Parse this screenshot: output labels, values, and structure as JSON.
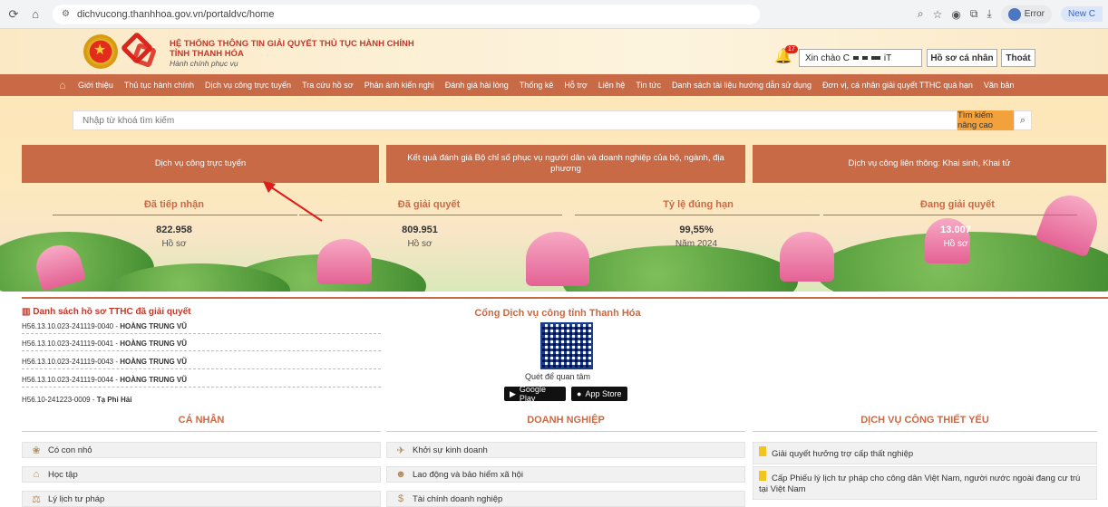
{
  "browser": {
    "url": "dichvucong.thanhhoa.gov.vn/portaldvc/home",
    "profile_label": "Error",
    "new_tab_label": "New C"
  },
  "header": {
    "title": "HỆ THỐNG THÔNG TIN GIẢI QUYẾT THỦ TỤC HÀNH CHÍNH",
    "subtitle": "TỈNH THANH HÓA",
    "tagline": "Hành chính phục vụ",
    "notification_count": "17",
    "greeting": "Xin chào C",
    "greeting_end": "iT",
    "profile_button": "Hồ sơ cá nhân",
    "logout_button": "Thoát"
  },
  "menu": {
    "items": [
      "Giới thiệu",
      "Thủ tục hành chính",
      "Dịch vụ công trực tuyến",
      "Tra cứu hồ sơ",
      "Phản ánh kiến nghị",
      "Đánh giá hài lòng",
      "Thống kê",
      "Hỗ trợ",
      "Liên hệ",
      "Tin tức",
      "Danh sách tài liệu hướng dẫn sử dụng",
      "Đơn vị, cá nhân giải quyết TTHC quá hạn",
      "Văn bản"
    ]
  },
  "search": {
    "placeholder": "Nhập từ khoá tìm kiếm",
    "advanced_button": "Tìm kiếm nâng cao"
  },
  "hero_buttons": {
    "online_services": "Dịch vụ công trực tuyến",
    "evaluation": "Kết quả đánh giá Bộ chỉ số phục vụ người dân và doanh nghiệp của bộ, ngành, địa phương",
    "interconnected": "Dịch vụ công liên thông: Khai sinh, Khai tử"
  },
  "stats": [
    {
      "label": "Đã tiếp nhận",
      "value": "822.958",
      "sub": "Hồ sơ"
    },
    {
      "label": "Đã giải quyết",
      "value": "809.951",
      "sub": "Hồ sơ"
    },
    {
      "label": "Tỷ lệ đúng hạn",
      "value": "99,55%",
      "sub": "Năm 2024"
    },
    {
      "label": "Đang giải quyết",
      "value": "13.007",
      "sub": "Hồ sơ"
    }
  ],
  "resolved_list": {
    "title": "Danh sách hồ sơ TTHC đã giải quyết",
    "rows": [
      {
        "code": "H56.13.10.023-241119-0040 - ",
        "name": "HOÀNG TRUNG VŨ"
      },
      {
        "code": "H56.13.10.023-241119-0041 - ",
        "name": "HOÀNG TRUNG VŨ"
      },
      {
        "code": "H56.13.10.023-241119-0043 - ",
        "name": "HOÀNG TRUNG VŨ"
      },
      {
        "code": "H56.13.10.023-241119-0044 - ",
        "name": "HOÀNG TRUNG VŨ"
      },
      {
        "code": "H56.10-241223-0009 - ",
        "name": "Tạ Phi Hải"
      }
    ]
  },
  "portal": {
    "title": "Cổng Dịch vụ công tỉnh Thanh Hóa",
    "qr_note": "Quét để quan tâm",
    "google_play": "Google Play",
    "app_store": "App Store"
  },
  "columns": {
    "personal": {
      "title": "CÁ NHÂN",
      "items": [
        {
          "label": "Có con nhỏ",
          "icon": "baby-icon"
        },
        {
          "label": "Học tập",
          "icon": "graduation-cap-icon"
        },
        {
          "label": "Lý lịch tư pháp",
          "icon": "justice-icon"
        }
      ]
    },
    "business": {
      "title": "DOANH NGHIỆP",
      "items": [
        {
          "label": "Khởi sự kinh doanh",
          "icon": "startup-icon"
        },
        {
          "label": "Lao động và bảo hiểm xã hội",
          "icon": "workers-icon"
        },
        {
          "label": "Tài chính doanh nghiệp",
          "icon": "dollar-icon"
        }
      ]
    },
    "essential": {
      "title": "DỊCH VỤ CÔNG THIẾT YẾU",
      "items": [
        "Giải quyết hưởng trợ cấp thất nghiệp",
        "Cấp Phiếu lý lịch tư pháp cho công dân Việt Nam, người nước ngoài đang cư trú tại Việt Nam"
      ]
    }
  },
  "colors": {
    "brand": "#c96a46",
    "title_red": "#c0392b",
    "search_button": "#f2a13b",
    "flag_yellow": "#f3c41d"
  }
}
